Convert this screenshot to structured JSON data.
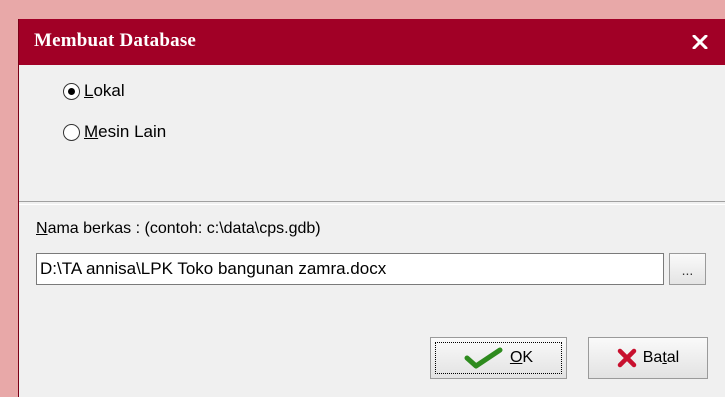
{
  "window": {
    "title": "Membuat Database",
    "close_icon": "close-icon"
  },
  "location": {
    "options": [
      {
        "accel": "L",
        "rest": "okal",
        "selected": true
      },
      {
        "accel": "M",
        "rest": "esin Lain",
        "selected": false
      }
    ]
  },
  "file": {
    "label_accel": "N",
    "label_rest": "ama berkas :  (contoh: c:\\data\\cps.gdb)",
    "value": "D:\\TA annisa\\LPK Toko bangunan zamra.docx",
    "browse_label": "..."
  },
  "buttons": {
    "ok_accel": "O",
    "ok_rest": "K",
    "ok_icon": "checkmark-icon",
    "cancel_pre": "Ba",
    "cancel_accel": "t",
    "cancel_post": "al",
    "cancel_icon": "x-icon"
  },
  "colors": {
    "titlebar": "#a10026",
    "dialog_bg": "#f0f0f0",
    "ok_check": "#2e8b1e",
    "cancel_x": "#c8102e"
  }
}
